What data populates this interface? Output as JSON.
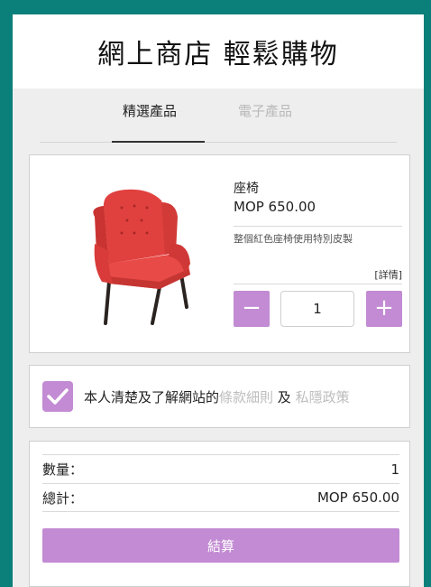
{
  "header": {
    "title": "網上商店 輕鬆購物"
  },
  "tabs": [
    {
      "label": "精選產品",
      "active": true
    },
    {
      "label": "電子產品",
      "active": false
    }
  ],
  "product": {
    "image_alt": "red-armchair",
    "name": "座椅",
    "price": "MOP 650.00",
    "description": "整個紅色座椅使用特別皮製",
    "details_link": "[詳情]",
    "quantity": "1",
    "minus_symbol": "−",
    "plus_symbol": "+"
  },
  "agreement": {
    "checked": true,
    "text_before": "本人清楚及了解網站的",
    "terms_link": "條款細則",
    "conjunction": " 及 ",
    "privacy_link": "私隱政策"
  },
  "summary": {
    "quantity_label": "數量：",
    "quantity_value": "1",
    "total_label": "總計：",
    "total_value": "MOP 650.00",
    "checkout_label": "結算"
  },
  "colors": {
    "border": "#0b7f79",
    "accent": "#c28bd3",
    "background": "#eeeeee"
  }
}
